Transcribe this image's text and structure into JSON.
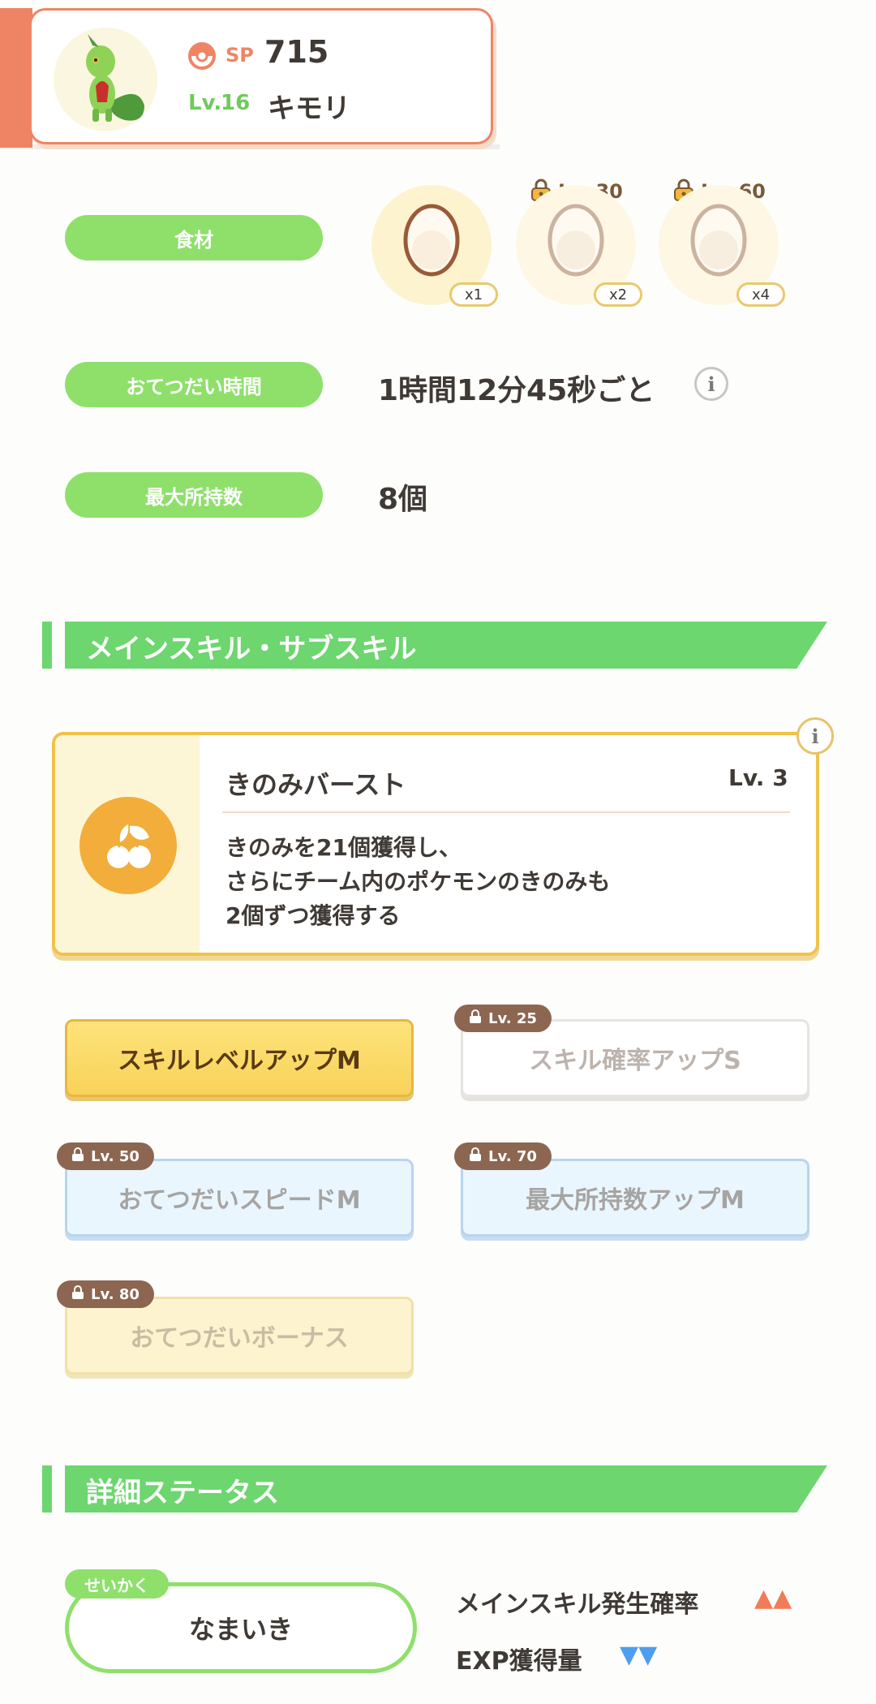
{
  "header": {
    "sp_label": "SP",
    "sp_value": "715",
    "level_label": "Lv.",
    "level_value": "16",
    "pokemon_name": "キモリ"
  },
  "ingredients": {
    "label": "食材",
    "slots": [
      {
        "count": "x1",
        "unlock": ""
      },
      {
        "count": "x2",
        "unlock": "Lv. 30"
      },
      {
        "count": "x4",
        "unlock": "Lv. 60"
      }
    ]
  },
  "help_time": {
    "label": "おてつだい時間",
    "value": "1時間12分45秒ごと"
  },
  "max_carry": {
    "label": "最大所持数",
    "value": "8個"
  },
  "skills_section": {
    "title": "メインスキル・サブスキル"
  },
  "main_skill": {
    "name": "きのみバースト",
    "level": "Lv. 3",
    "description": "きのみを21個獲得し、\nさらにチーム内のポケモンのきのみも\n2個ずつ獲得する"
  },
  "sub_skills": [
    {
      "name": "スキルレベルアップM",
      "unlock": ""
    },
    {
      "name": "スキル確率アップS",
      "unlock": "Lv. 25"
    },
    {
      "name": "おてつだいスピードM",
      "unlock": "Lv. 50"
    },
    {
      "name": "最大所持数アップM",
      "unlock": "Lv. 70"
    },
    {
      "name": "おてつだいボーナス",
      "unlock": "Lv. 80"
    }
  ],
  "status_section": {
    "title": "詳細ステータス"
  },
  "nature": {
    "tag": "せいかく",
    "value": "なまいき"
  },
  "nature_effects": [
    {
      "label": "メインスキル発生確率",
      "arrows": "▲▲",
      "color": "#f07c58"
    },
    {
      "label": "EXP獲得量",
      "arrows": "▼▼",
      "color": "#4e9ef0"
    }
  ],
  "colors": {
    "accent_orange": "#ef8465",
    "green": "#8ee06b",
    "section_green": "#6dd66f",
    "gold": "#f0c24a"
  },
  "icons": [
    "pokeball-icon",
    "treecko-avatar",
    "egg-icon",
    "lock-icon",
    "info-icon",
    "berry-burst-icon"
  ]
}
